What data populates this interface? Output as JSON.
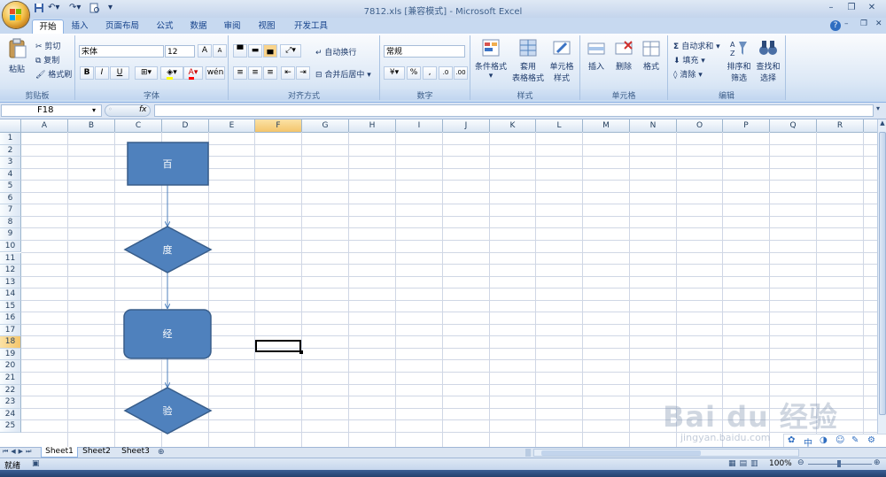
{
  "window": {
    "title": "7812.xls  [兼容模式] - Microsoft Excel"
  },
  "quick_access": {
    "save": "save-icon",
    "undo": "undo-icon",
    "redo": "redo-icon",
    "print_preview": "print-preview-icon"
  },
  "tabs": [
    "开始",
    "插入",
    "页面布局",
    "公式",
    "数据",
    "审阅",
    "视图",
    "开发工具"
  ],
  "ribbon": {
    "clipboard": {
      "paste": "粘贴",
      "cut": "剪切",
      "copy": "复制",
      "format_painter": "格式刷",
      "group": "剪贴板"
    },
    "font": {
      "name": "宋体",
      "size": "12",
      "grow": "A",
      "shrink": "A",
      "bold": "B",
      "italic": "I",
      "underline": "U",
      "group": "字体"
    },
    "alignment": {
      "wrap": "自动换行",
      "merge": "合并后居中",
      "group": "对齐方式"
    },
    "number": {
      "format": "常规",
      "percent": "%",
      "comma": ",",
      "group": "数字"
    },
    "styles": {
      "conditional": "条件格式",
      "table_l1": "套用",
      "table_l2": "表格格式",
      "cell_l1": "单元格",
      "cell_l2": "样式",
      "group": "样式"
    },
    "cells": {
      "insert": "插入",
      "delete": "删除",
      "format": "格式",
      "group": "单元格"
    },
    "editing": {
      "autosum": "自动求和",
      "fill": "填充",
      "clear": "清除",
      "sort_l1": "排序和",
      "sort_l2": "筛选",
      "find_l1": "查找和",
      "find_l2": "选择",
      "group": "编辑"
    }
  },
  "formula_bar": {
    "name_box": "F18",
    "fx": "fx",
    "value": ""
  },
  "columns": [
    "A",
    "B",
    "C",
    "D",
    "E",
    "F",
    "G",
    "H",
    "I",
    "J",
    "K",
    "L",
    "M",
    "N",
    "O",
    "P",
    "Q",
    "R"
  ],
  "rows": [
    "1",
    "2",
    "3",
    "4",
    "5",
    "6",
    "7",
    "8",
    "9",
    "10",
    "11",
    "12",
    "13",
    "14",
    "15",
    "16",
    "17",
    "18",
    "19",
    "20",
    "21",
    "22",
    "23",
    "24",
    "25"
  ],
  "selected_cell": "F18",
  "flowchart": {
    "box1": "百",
    "diamond1": "度",
    "box2": "经",
    "diamond2": "验",
    "fill": "#4f81bd",
    "stroke": "#385d8a"
  },
  "sheets": [
    "Sheet1",
    "Sheet2",
    "Sheet3"
  ],
  "status": {
    "ready": "就绪",
    "zoom": "100%"
  },
  "watermark": {
    "brand": "Bai du 经验",
    "url": "jingyan.baidu.com"
  },
  "ime": {
    "lang": "中"
  }
}
